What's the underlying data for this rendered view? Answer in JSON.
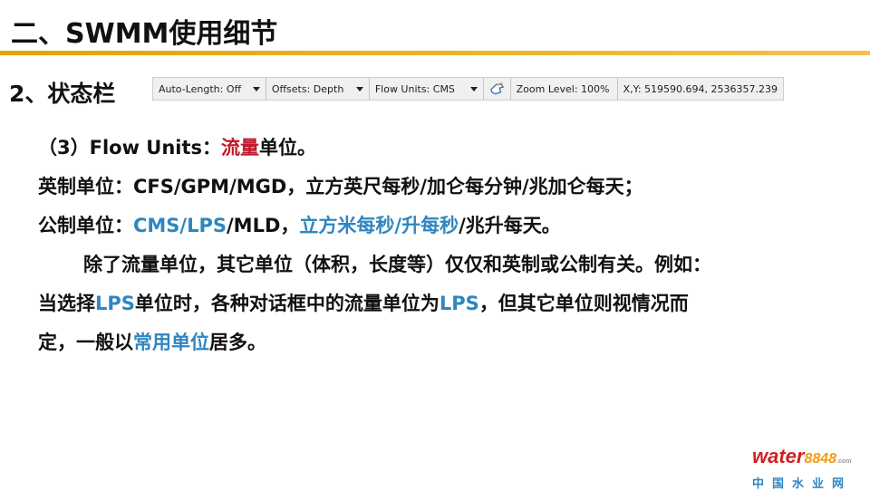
{
  "title": "二、SWMM使用细节",
  "section": "2、状态栏",
  "statusbar": {
    "auto_length": "Auto-Length: Off",
    "offsets": "Offsets: Depth",
    "flow_units": "Flow Units: CMS",
    "zoom": "Zoom Level: 100%",
    "xy": "X,Y: 519590.694, 2536357.239"
  },
  "content": {
    "l1_a": "（3）Flow Units：",
    "l1_b": "流量",
    "l1_c": "单位。",
    "l2": "英制单位：CFS/GPM/MGD，立方英尺每秒/加仑每分钟/兆加仑每天；",
    "l3_a": "公制单位：",
    "l3_b": "CMS/LPS",
    "l3_c": "/MLD，",
    "l3_d": "立方米每秒/升每秒",
    "l3_e": "/兆升每天。",
    "l4": "除了流量单位，其它单位（体积，长度等）仅仅和英制或公制有关。例如：",
    "l5_a": "当选择",
    "l5_b": "LPS",
    "l5_c": "单位时，各种对话框中的流量单位为",
    "l5_d": "LPS",
    "l5_e": "，但其它单位则视情况而",
    "l6_a": "定，一般以",
    "l6_b": "常用单位",
    "l6_c": "居多。"
  },
  "logo": {
    "word": "water",
    "number": "8848",
    "domain": ".com",
    "cn": "中国水业网"
  },
  "colors": {
    "accent_rule": "#e8a200",
    "red": "#c0192b",
    "blue": "#2e86c1"
  }
}
